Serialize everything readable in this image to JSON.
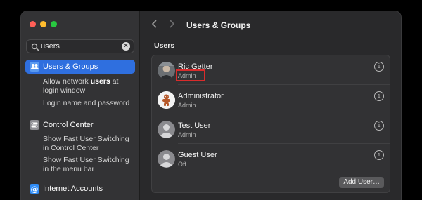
{
  "window": {
    "title": "Users & Groups"
  },
  "search": {
    "value": "users"
  },
  "sidebar": {
    "items": [
      {
        "label": "Users & Groups",
        "selected": true,
        "icon": "users-groups-icon",
        "color": "#2f6fdf"
      },
      {
        "label": "Control Center",
        "icon": "control-center-icon",
        "color": "#8e8e93"
      },
      {
        "label": "Internet Accounts",
        "icon": "at-sign-icon",
        "color": "#2f8cf6"
      }
    ],
    "subitems": {
      "users_groups": [
        {
          "pre": "Allow network ",
          "bold": "users",
          "post": " at login window"
        },
        {
          "pre": "Login name and password",
          "bold": "",
          "post": ""
        }
      ],
      "control_center": [
        {
          "text": "Show Fast User Switching in Control Center"
        },
        {
          "text": "Show Fast User Switching in the menu bar"
        }
      ]
    }
  },
  "main": {
    "section_label": "Users",
    "users": [
      {
        "name": "Ric Getter",
        "role": "Admin",
        "avatar": "photo-avatar"
      },
      {
        "name": "Administrator",
        "role": "Admin",
        "avatar": "gingerbread-avatar"
      },
      {
        "name": "Test User",
        "role": "Admin",
        "avatar": "generic-avatar"
      },
      {
        "name": "Guest User",
        "role": "Off",
        "avatar": "generic-avatar"
      }
    ],
    "add_user_label": "Add User…"
  },
  "colors": {
    "accent": "#2f6fdf",
    "highlight": "#d92c2c"
  }
}
